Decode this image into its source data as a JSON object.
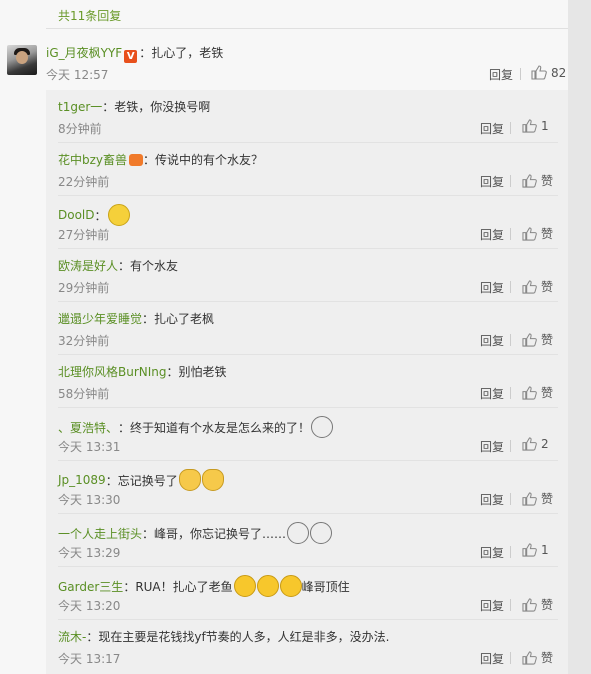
{
  "total_replies": "共11条回复",
  "main_comment": {
    "user": "iG_月夜枫YYF",
    "verified_badge": "V",
    "text": "：扎心了，老铁",
    "time": "今天 12:57",
    "reply_label": "回复",
    "likes": "82"
  },
  "replies": [
    {
      "user": "t1ger一",
      "text": "：老铁，你没换号啊",
      "time": "8分钟前",
      "reply_label": "回复",
      "like_label": "1",
      "emojis": [],
      "badge": ""
    },
    {
      "user": "花中bzy畜兽",
      "badge": "fire-badge",
      "text": "：传说中的有个水友？",
      "time": "22分钟前",
      "reply_label": "回复",
      "like_label": "赞",
      "emojis": []
    },
    {
      "user": "DoolD",
      "text": "：",
      "time": "27分钟前",
      "reply_label": "回复",
      "like_label": "赞",
      "emojis": [
        "grin-emoji"
      ],
      "badge": ""
    },
    {
      "user": "欧涛是好人",
      "text": "：有个水友",
      "time": "29分钟前",
      "reply_label": "回复",
      "like_label": "赞",
      "emojis": [],
      "badge": ""
    },
    {
      "user": "邋遢少年爱睡觉",
      "text": "：扎心了老枫",
      "time": "32分钟前",
      "reply_label": "回复",
      "like_label": "赞",
      "emojis": [],
      "badge": ""
    },
    {
      "user": "北理你风格BurNIng",
      "text": "：别怕老铁",
      "time": "58分钟前",
      "reply_label": "回复",
      "like_label": "赞",
      "emojis": [],
      "badge": ""
    },
    {
      "user": "、夏浩特、",
      "text": "：终于知道有个水友是怎么来的了！",
      "time": "今天 13:31",
      "reply_label": "回复",
      "like_label": "2",
      "emojis": [
        "husky-emoji"
      ],
      "badge": ""
    },
    {
      "user": "Jp_1089",
      "text": "：忘记换号了",
      "time": "今天 13:30",
      "reply_label": "回复",
      "like_label": "赞",
      "emojis": [
        "cat-emoji",
        "cat-emoji"
      ],
      "badge": ""
    },
    {
      "user": "一个人走上街头",
      "text": "：峰哥，你忘记换号了……",
      "time": "今天 13:29",
      "reply_label": "回复",
      "like_label": "1",
      "emojis": [
        "husky-emoji",
        "husky-emoji"
      ],
      "badge": ""
    },
    {
      "user": "Garder三生",
      "text": "：RUA！扎心了老鱼",
      "text_after": "峰哥顶住",
      "time": "今天 13:20",
      "reply_label": "回复",
      "like_label": "赞",
      "emojis": [
        "laugh-emoji",
        "laugh-emoji",
        "laugh-emoji"
      ],
      "badge": ""
    },
    {
      "user": "流木-",
      "text": "：现在主要是花钱找yf节奏的人多，人红是非多，没办法.",
      "time": "今天 13:17",
      "reply_label": "回复",
      "like_label": "赞",
      "emojis": [],
      "badge": ""
    }
  ]
}
